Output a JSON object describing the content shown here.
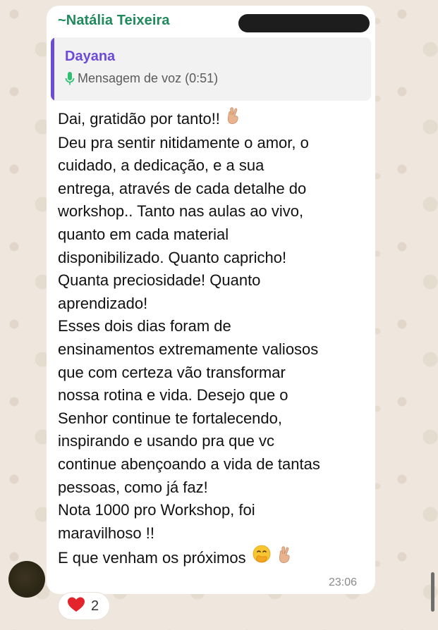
{
  "message": {
    "sender_name": "~Natália Teixeira",
    "quoted": {
      "author": "Dayana",
      "detail": "Mensagem de voz (0:51)",
      "icon": "mic-icon",
      "accent_color": "#6c4bd8"
    },
    "lines": [
      "Dai, gratidão por tanto!!",
      "Deu pra sentir nitidamente o amor, o",
      "cuidado, a dedicação, e a sua",
      "entrega, através de cada detalhe do",
      "workshop.. Tanto nas aulas ao vivo,",
      "quanto em cada material",
      "disponibilizado. Quanto capricho!",
      "Quanta preciosidade! Quanto",
      "aprendizado!",
      "Esses dois dias foram de",
      "ensinamentos extremamente valiosos",
      "que com certeza vão transformar",
      "nossa rotina e vida. Desejo que o",
      "Senhor continue te fortalecendo,",
      "inspirando e usando pra que vc",
      "continue abençoando a vida de tantas",
      "pessoas, como já faz!",
      "Nota 1000 pro Workshop, foi",
      "maravilhoso !!",
      "E que venham os próximos"
    ],
    "emojis": {
      "line_1": "crossed-fingers-icon",
      "line_20": [
        "hand-over-mouth-icon",
        "crossed-fingers-icon"
      ]
    },
    "time": "23:06",
    "sender_color": "#1f8a5b"
  },
  "reaction": {
    "icon": "heart-icon",
    "count": "2"
  }
}
